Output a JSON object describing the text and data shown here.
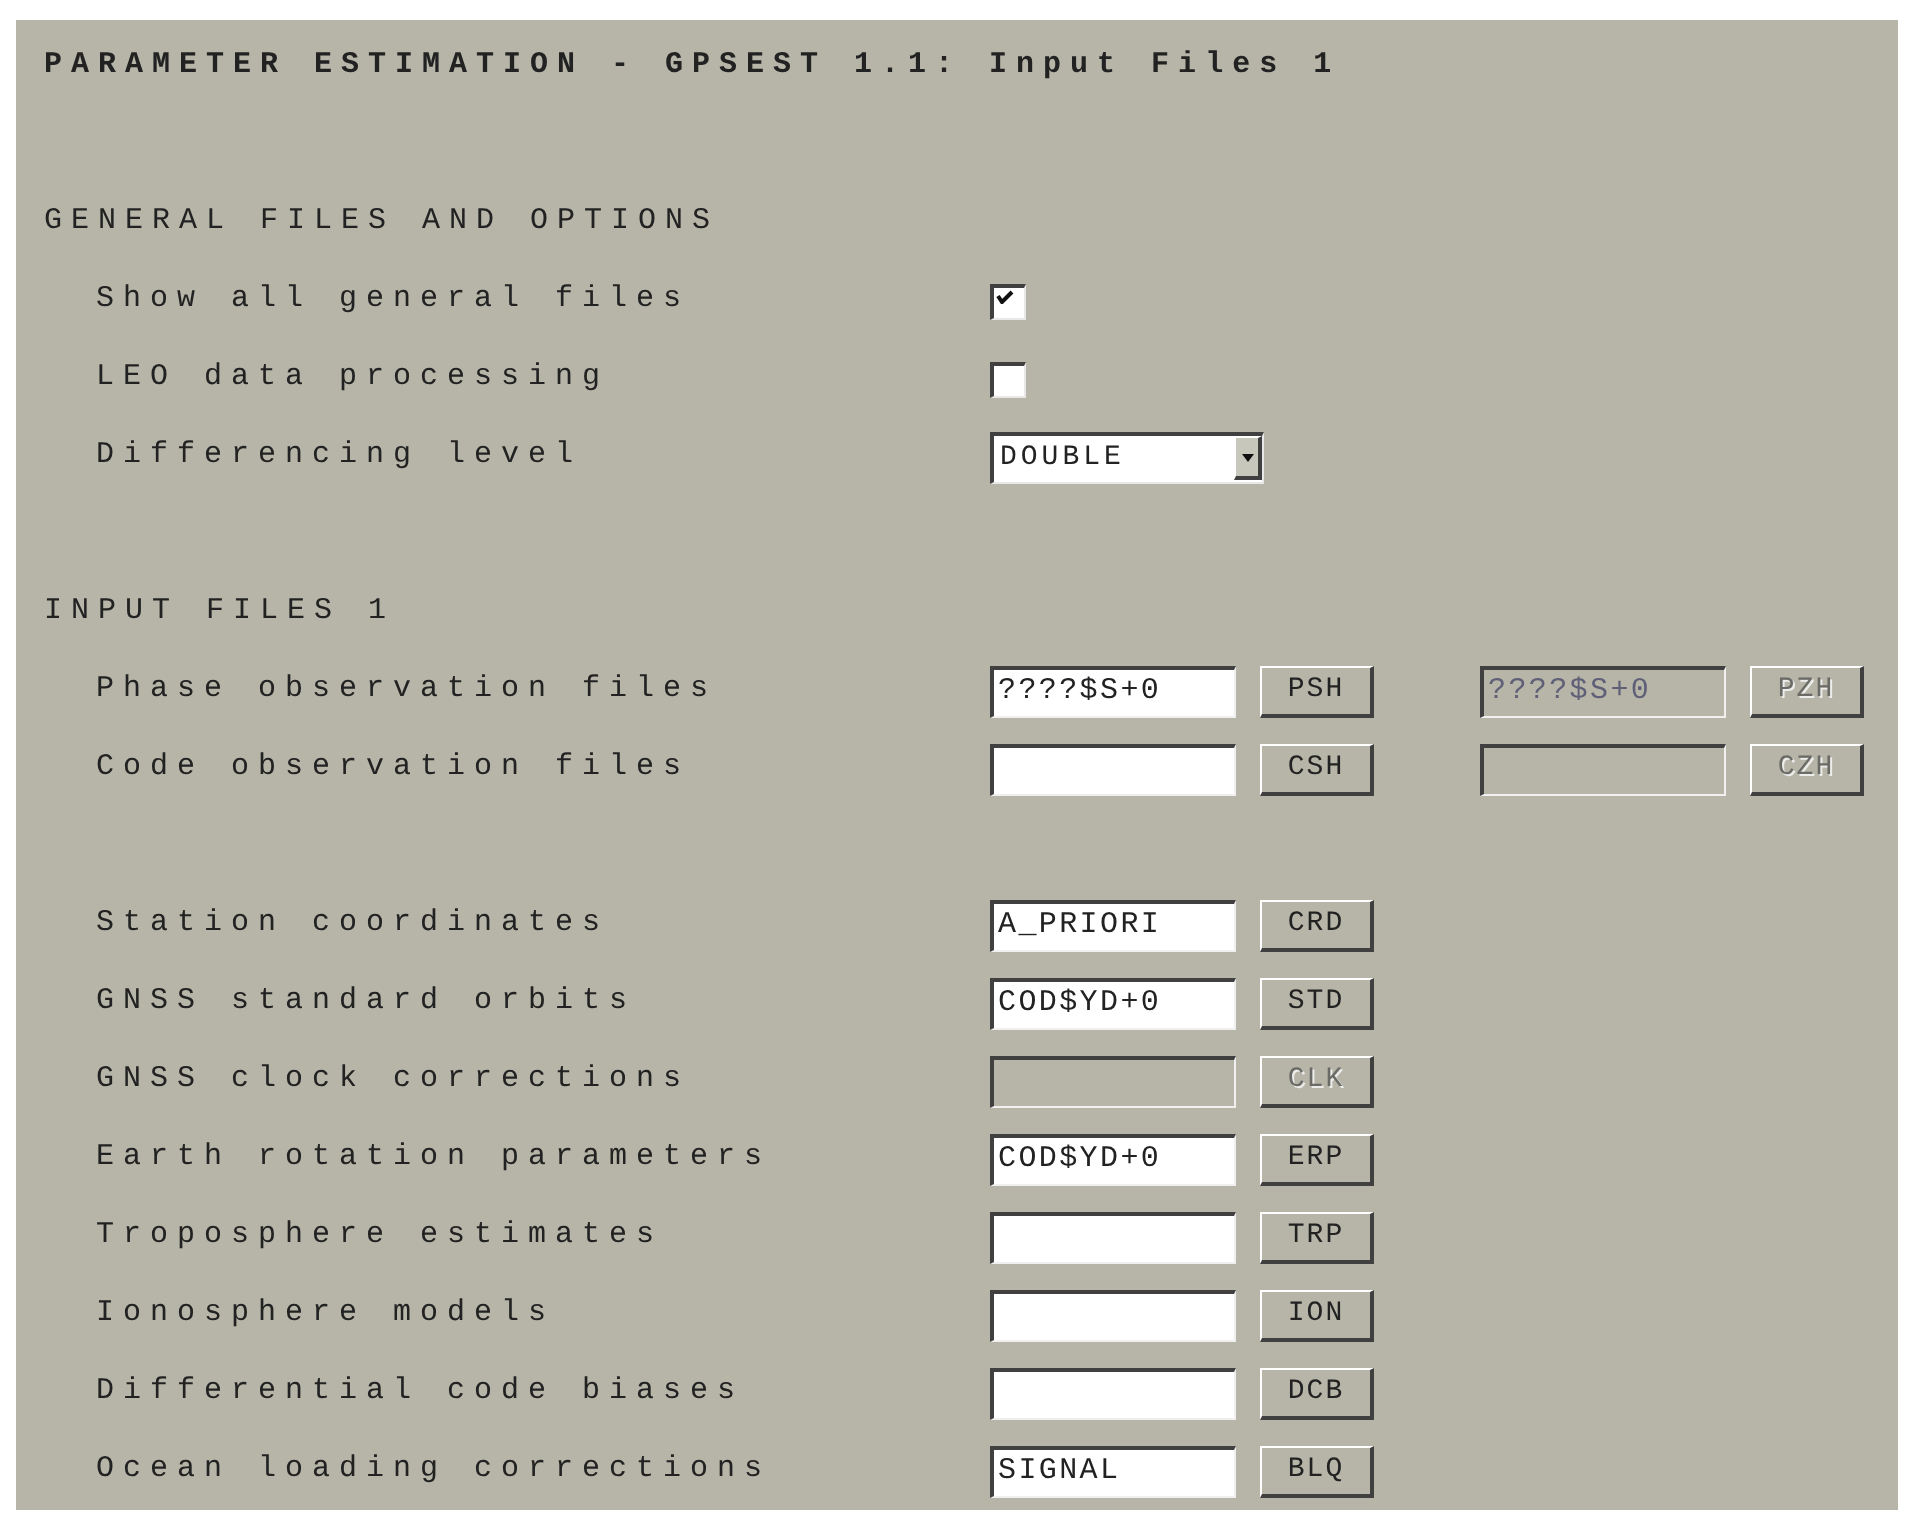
{
  "title": "PARAMETER ESTIMATION - GPSEST 1.1: Input Files 1",
  "sections": [
    {
      "title": "GENERAL FILES AND OPTIONS",
      "groups": [
        [
          {
            "kind": "checkbox",
            "label": "Show all general files",
            "checked": true
          },
          {
            "kind": "checkbox",
            "label": "LEO data processing",
            "checked": false
          },
          {
            "kind": "dropdown",
            "label": "Differencing level",
            "value": "DOUBLE"
          }
        ]
      ]
    },
    {
      "title": "INPUT FILES 1",
      "groups": [
        [
          {
            "kind": "files",
            "label": "Phase observation files",
            "inputs": [
              {
                "value": "????$S+0",
                "disabled": false,
                "button": "PSH"
              },
              {
                "value": "????$S+0",
                "disabled": true,
                "button": "PZH"
              }
            ]
          },
          {
            "kind": "files",
            "label": "Code observation files",
            "inputs": [
              {
                "disabled": false,
                "button": "CSH"
              },
              {
                "disabled": true,
                "button": "CZH"
              }
            ]
          }
        ],
        [
          {
            "kind": "files",
            "label": "Station coordinates",
            "inputs": [
              {
                "value": "A_PRIORI",
                "disabled": false,
                "button": "CRD"
              }
            ]
          },
          {
            "kind": "files",
            "label": "GNSS standard orbits",
            "inputs": [
              {
                "value": "COD$YD+0",
                "disabled": false,
                "button": "STD"
              }
            ]
          },
          {
            "kind": "files",
            "label": "GNSS clock corrections",
            "inputs": [
              {
                "disabled": true,
                "button": "CLK"
              }
            ]
          },
          {
            "kind": "files",
            "label": "Earth rotation parameters",
            "inputs": [
              {
                "value": "COD$YD+0",
                "disabled": false,
                "button": "ERP"
              }
            ]
          },
          {
            "kind": "files",
            "label": "Troposphere estimates",
            "inputs": [
              {
                "disabled": false,
                "button": "TRP"
              }
            ]
          },
          {
            "kind": "files",
            "label": "Ionosphere models",
            "inputs": [
              {
                "disabled": false,
                "button": "ION"
              }
            ]
          },
          {
            "kind": "files",
            "label": "Differential code biases",
            "inputs": [
              {
                "disabled": false,
                "button": "DCB"
              }
            ]
          },
          {
            "kind": "files",
            "label": "Ocean loading corrections",
            "inputs": [
              {
                "value": "SIGNAL",
                "disabled": false,
                "button": "BLQ"
              }
            ]
          }
        ]
      ]
    }
  ]
}
